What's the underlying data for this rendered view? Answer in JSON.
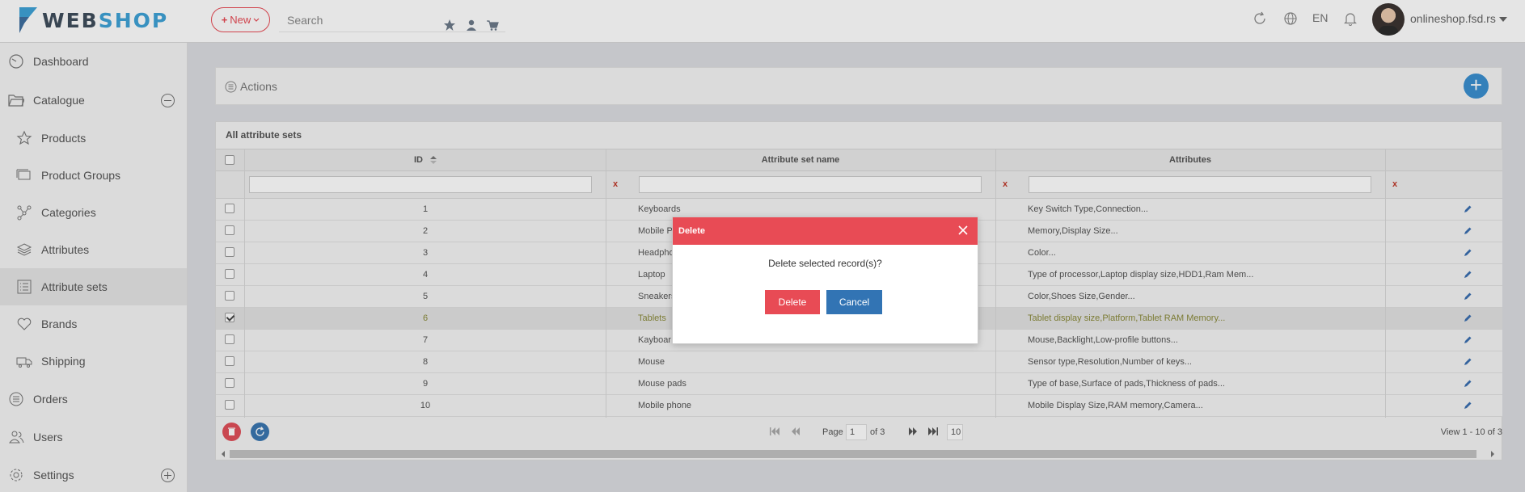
{
  "brand": {
    "part1": "WEB",
    "part2": "SHOP"
  },
  "toolbar": {
    "new_label": "New",
    "search_placeholder": "Search"
  },
  "header_right": {
    "language": "EN",
    "shop": "onlineshop.fsd.rs"
  },
  "sidebar": {
    "items": [
      {
        "label": "Dashboard",
        "icon": "speedometer-icon"
      },
      {
        "label": "Catalogue",
        "icon": "folder-icon",
        "expanded": true
      },
      {
        "label": "Products",
        "icon": "star-icon"
      },
      {
        "label": "Product Groups",
        "icon": "stack-icon"
      },
      {
        "label": "Categories",
        "icon": "network-icon"
      },
      {
        "label": "Attributes",
        "icon": "layers-icon"
      },
      {
        "label": "Attribute sets",
        "icon": "list-icon",
        "active": true
      },
      {
        "label": "Brands",
        "icon": "heart-icon"
      },
      {
        "label": "Shipping",
        "icon": "truck-icon"
      },
      {
        "label": "Orders",
        "icon": "list-circle-icon"
      },
      {
        "label": "Users",
        "icon": "users-icon"
      },
      {
        "label": "Settings",
        "icon": "gear-icon",
        "expanded": false
      }
    ]
  },
  "actions": {
    "label": "Actions"
  },
  "grid": {
    "title": "All attribute sets",
    "columns": [
      "ID",
      "Attribute set name",
      "Attributes"
    ],
    "clear_symbol": "x",
    "rows": [
      {
        "id": "1",
        "name": "Keyboards",
        "attributes": "Key Switch Type,Connection..."
      },
      {
        "id": "2",
        "name": "Mobile P",
        "attributes": "Memory,Display Size..."
      },
      {
        "id": "3",
        "name": "Headpho",
        "attributes": "Color..."
      },
      {
        "id": "4",
        "name": "Laptop",
        "attributes": "Type of processor,Laptop display size,HDD1,Ram Mem..."
      },
      {
        "id": "5",
        "name": "Sneakers",
        "attributes": "Color,Shoes Size,Gender..."
      },
      {
        "id": "6",
        "name": "Tablets",
        "attributes": "Tablet display size,Platform,Tablet RAM Memory...",
        "selected": true
      },
      {
        "id": "7",
        "name": "Kayboar",
        "attributes": "Mouse,Backlight,Low-profile buttons..."
      },
      {
        "id": "8",
        "name": "Mouse",
        "attributes": "Sensor type,Resolution,Number of keys..."
      },
      {
        "id": "9",
        "name": "Mouse pads",
        "attributes": "Type of base,Surface of pads,Thickness of pads..."
      },
      {
        "id": "10",
        "name": "Mobile phone",
        "attributes": "Mobile Display Size,RAM memory,Camera..."
      }
    ]
  },
  "pager": {
    "page_label": "Page",
    "page_value": "1",
    "of_label": "of 3",
    "page_size": "10",
    "view_info": "View 1 - 10 of 3"
  },
  "dialog": {
    "title": "Delete",
    "message": "Delete selected record(s)?",
    "confirm_label": "Delete",
    "cancel_label": "Cancel"
  },
  "colors": {
    "accent_red": "#e84b55",
    "accent_blue": "#3274b4",
    "brand_blue": "#3fa2d6"
  }
}
